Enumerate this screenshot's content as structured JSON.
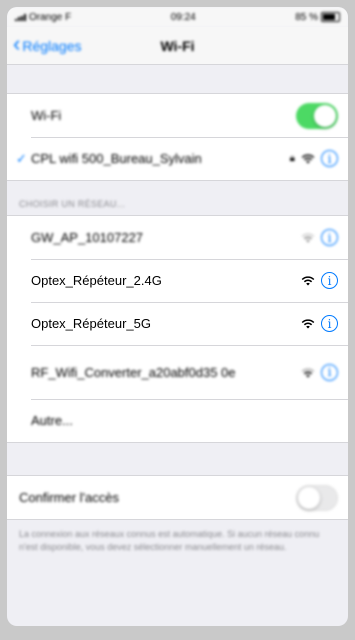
{
  "status_bar": {
    "carrier": "Orange F",
    "time": "09:24",
    "battery": "85 %"
  },
  "nav": {
    "back_label": "Réglages",
    "title": "Wi-Fi"
  },
  "wifi_section": {
    "toggle_label": "Wi-Fi",
    "toggle_on": true,
    "connected_network": "CPL wifi 500_Bureau_Sylvain"
  },
  "networks_header": "CHOISIR UN RÉSEAU...",
  "networks": [
    {
      "name": "GW_AP_10107227"
    },
    {
      "name": "Optex_Répéteur_2.4G"
    },
    {
      "name": "Optex_Répéteur_5G"
    },
    {
      "name": "RF_Wifi_Converter_a20abf0d35 0e"
    }
  ],
  "other_label": "Autre...",
  "ask_join": {
    "label": "Confirmer l'accès",
    "toggle_on": false,
    "footnote": "La connexion aux réseaux connus est automatique. Si aucun réseau connu n'est disponible, vous devez sélectionner manuellement un réseau."
  },
  "colors": {
    "accent": "#007aff",
    "toggle_on": "#4cd964",
    "background": "#efeff4"
  },
  "icons": {
    "wifi": "wifi-icon",
    "info": "info-icon",
    "lock": "lock-icon",
    "check": "checkmark-icon",
    "back": "chevron-left-icon"
  }
}
